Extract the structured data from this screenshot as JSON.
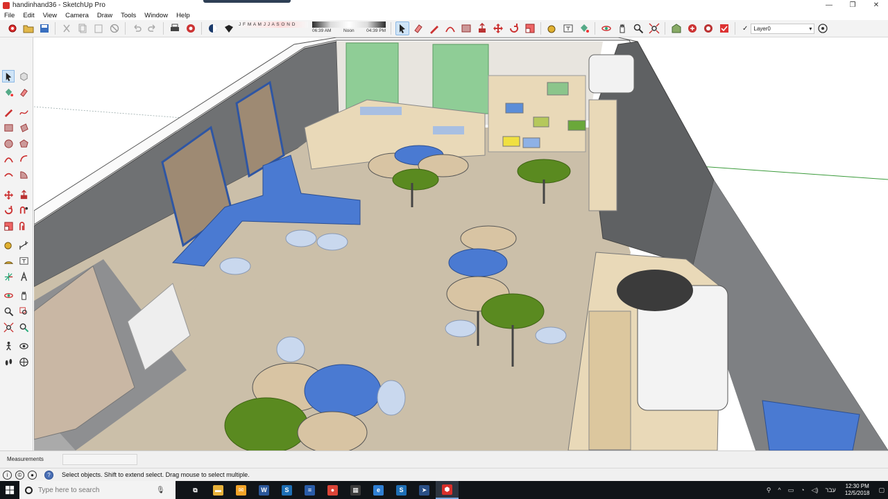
{
  "window": {
    "title": "handinhand36 - SketchUp Pro",
    "controls": {
      "minimize": "—",
      "maximize": "❐",
      "close": "✕"
    }
  },
  "menu": [
    "File",
    "Edit",
    "View",
    "Camera",
    "Draw",
    "Tools",
    "Window",
    "Help"
  ],
  "toolbar": {
    "months": "J F M A M J J A S O N D",
    "time_start": "06:39 AM",
    "time_mid": "Noon",
    "time_end": "04:39 PM",
    "layer_label": "Layer0"
  },
  "status": {
    "measurements_label": "Measurements",
    "measurements_value": "",
    "hint": "Select objects. Shift to extend select. Drag mouse to select multiple."
  },
  "taskbar": {
    "search_placeholder": "Type here to search",
    "apps": [
      {
        "name": "task-view",
        "glyph": "⧉",
        "color": "#101418"
      },
      {
        "name": "file-explorer",
        "glyph": "▬",
        "color": "#e8b23a"
      },
      {
        "name": "outlook-mail",
        "glyph": "✉",
        "color": "#f3a428"
      },
      {
        "name": "word",
        "glyph": "W",
        "color": "#2b579a"
      },
      {
        "name": "sketchup",
        "glyph": "S",
        "color": "#1e6fb5"
      },
      {
        "name": "calendar-app",
        "glyph": "≡",
        "color": "#2a5ca8"
      },
      {
        "name": "chrome",
        "glyph": "●",
        "color": "#db4437"
      },
      {
        "name": "calculator",
        "glyph": "▦",
        "color": "#3b3b3b"
      },
      {
        "name": "edge",
        "glyph": "e",
        "color": "#2f7fd3"
      },
      {
        "name": "sketchup-2",
        "glyph": "S",
        "color": "#1e6fb5"
      },
      {
        "name": "arrow-app",
        "glyph": "➤",
        "color": "#2a4f85"
      },
      {
        "name": "sketchup-pro",
        "glyph": "⬢",
        "color": "#d9302b"
      }
    ],
    "tray": {
      "language": "עבר",
      "time": "12:30 PM",
      "date": "12/5/2018"
    }
  },
  "colors": {
    "wall": "#6f7173",
    "floor": "#cbbfa9",
    "blue_table": "#4a7ad2",
    "green_table": "#5a8a20",
    "wood_table": "#d8c4a3",
    "curtain": "#8fcd96",
    "chair": "#c9d8ee"
  }
}
